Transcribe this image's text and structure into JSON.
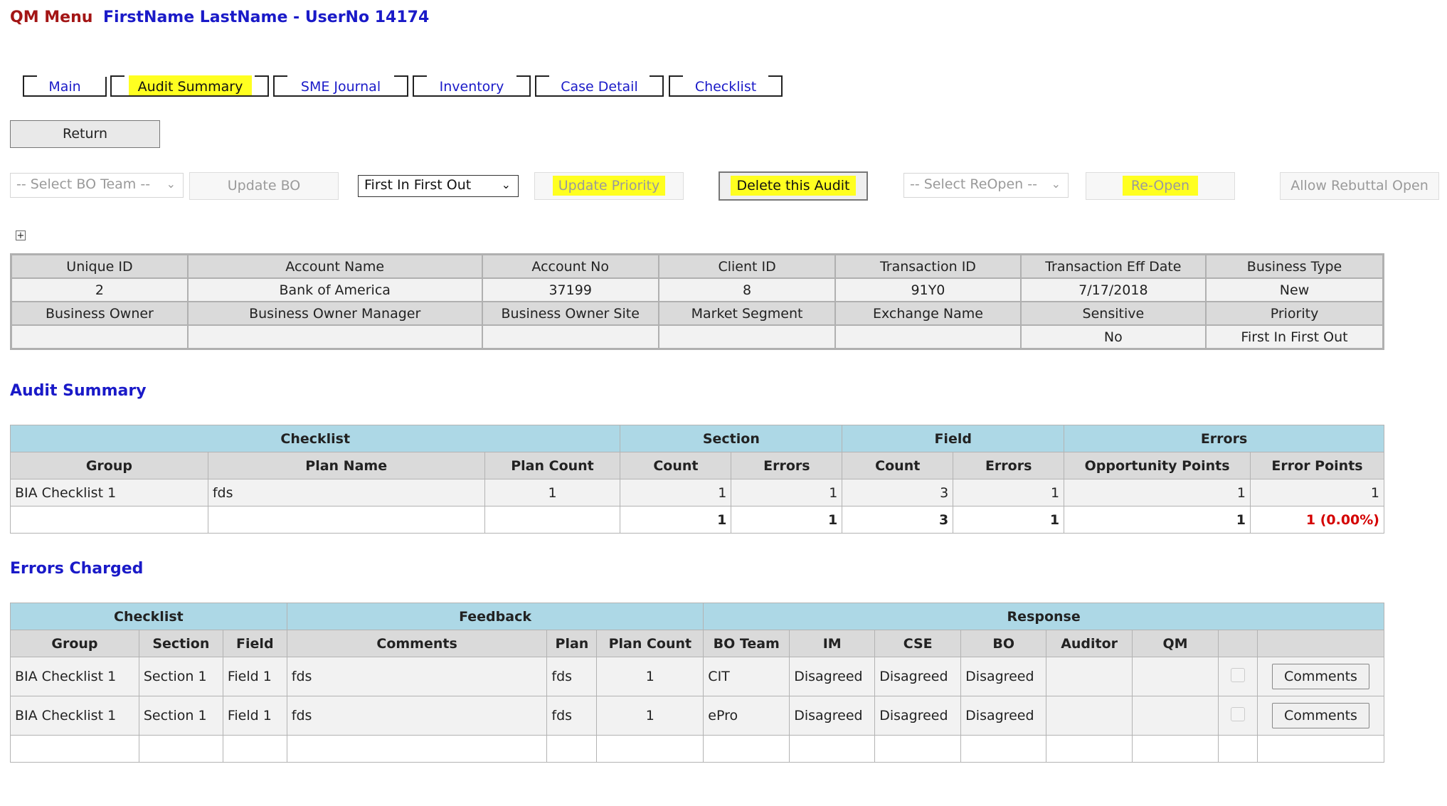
{
  "header": {
    "app_title": "QM Menu",
    "user": "FirstName LastName - UserNo 14174"
  },
  "tabs": [
    {
      "label": "Main",
      "active": false
    },
    {
      "label": "Audit Summary",
      "active": true
    },
    {
      "label": "SME Journal",
      "active": false
    },
    {
      "label": "Inventory",
      "active": false
    },
    {
      "label": "Case Detail",
      "active": false
    },
    {
      "label": "Checklist",
      "active": false
    }
  ],
  "return_button": "Return",
  "toolbar": {
    "bo_team_select": "-- Select BO Team --",
    "update_bo": "Update BO",
    "priority_select": "First In First Out",
    "update_priority": "Update Priority",
    "delete_audit": "Delete this Audit",
    "reopen_select": "-- Select ReOpen --",
    "reopen": "Re-Open",
    "allow_rebuttal": "Allow Rebuttal Open"
  },
  "expander": "+",
  "info": {
    "headers1": [
      "Unique ID",
      "Account Name",
      "Account No",
      "Client ID",
      "Transaction ID",
      "Transaction Eff Date",
      "Business Type"
    ],
    "values1": [
      "2",
      "Bank of America",
      "37199",
      "8",
      "91Y0",
      "7/17/2018",
      "New"
    ],
    "headers2": [
      "Business Owner",
      "Business Owner Manager",
      "Business Owner Site",
      "Market Segment",
      "Exchange Name",
      "Sensitive",
      "Priority"
    ],
    "values2": [
      "",
      "",
      "",
      "",
      "",
      "No",
      "First In First Out"
    ]
  },
  "audit_summary": {
    "title": "Audit Summary",
    "groups": [
      "Checklist",
      "Section",
      "Field",
      "Errors"
    ],
    "columns": [
      "Group",
      "Plan Name",
      "Plan Count",
      "Count",
      "Errors",
      "Count",
      "Errors",
      "Opportunity Points",
      "Error Points"
    ],
    "row": [
      "BIA Checklist 1",
      "fds",
      "1",
      "1",
      "1",
      "3",
      "1",
      "1",
      "1"
    ],
    "totals": [
      "",
      "",
      "",
      "1",
      "1",
      "3",
      "1",
      "1",
      "1 (0.00%)"
    ]
  },
  "errors_charged": {
    "title": "Errors Charged",
    "groups": [
      "Checklist",
      "Feedback",
      "Response"
    ],
    "columns": [
      "Group",
      "Section",
      "Field",
      "Comments",
      "Plan",
      "Plan Count",
      "BO Team",
      "IM",
      "CSE",
      "BO",
      "Auditor",
      "QM",
      "",
      ""
    ],
    "rows": [
      {
        "group": "BIA Checklist 1",
        "section": "Section 1",
        "field": "Field 1",
        "comments": "fds",
        "plan": "fds",
        "plan_count": "1",
        "bo_team": "CIT",
        "im": "Disagreed",
        "cse": "Disagreed",
        "bo": "Disagreed",
        "auditor": "",
        "qm": "",
        "button": "Comments"
      },
      {
        "group": "BIA Checklist 1",
        "section": "Section 1",
        "field": "Field 1",
        "comments": "fds",
        "plan": "fds",
        "plan_count": "1",
        "bo_team": "ePro",
        "im": "Disagreed",
        "cse": "Disagreed",
        "bo": "Disagreed",
        "auditor": "",
        "qm": "",
        "button": "Comments"
      }
    ]
  },
  "colors": {
    "app_title": "#a31515",
    "user": "#1a1ac8",
    "highlight": "#ffff20",
    "group_header": "#add8e6",
    "error_text": "#d40000"
  }
}
